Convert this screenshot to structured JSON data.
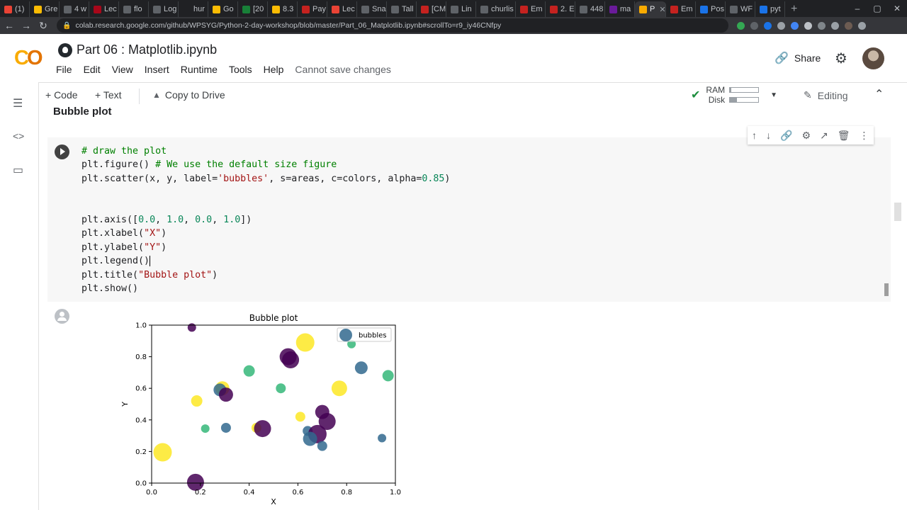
{
  "browser": {
    "tabs": [
      {
        "label": "(1)",
        "color": "#ea4335"
      },
      {
        "label": "Gre",
        "color": "#fbbc04"
      },
      {
        "label": "4 w",
        "color": "#5f6368"
      },
      {
        "label": "Lec",
        "color": "#a8071a"
      },
      {
        "label": "flo",
        "color": "#5f6368"
      },
      {
        "label": "Log",
        "color": "#5f6368"
      },
      {
        "label": "hur",
        "color": "#202124"
      },
      {
        "label": "Go",
        "color": "#fbbc04"
      },
      {
        "label": "[20",
        "color": "#188038"
      },
      {
        "label": "8.3",
        "color": "#fbbc04"
      },
      {
        "label": "Pay",
        "color": "#c5221f"
      },
      {
        "label": "Lec",
        "color": "#ea4335"
      },
      {
        "label": "Sna",
        "color": "#5f6368"
      },
      {
        "label": "Tall",
        "color": "#5f6368"
      },
      {
        "label": "[CM",
        "color": "#c5221f"
      },
      {
        "label": "Lin",
        "color": "#5f6368"
      },
      {
        "label": "churlis",
        "color": "#5f6368"
      },
      {
        "label": "Em",
        "color": "#c5221f"
      },
      {
        "label": "2. E",
        "color": "#c5221f"
      },
      {
        "label": "448",
        "color": "#5f6368"
      },
      {
        "label": "ma",
        "color": "#6a1b9a"
      },
      {
        "label": "P",
        "color": "#f9ab00",
        "active": true
      },
      {
        "label": "Em",
        "color": "#c5221f"
      },
      {
        "label": "Pos",
        "color": "#1a73e8"
      },
      {
        "label": "WF",
        "color": "#5f6368"
      },
      {
        "label": "pyt",
        "color": "#1a73e8"
      }
    ],
    "new_tab": "+",
    "window_controls": [
      "–",
      "▢",
      "✕"
    ],
    "url": "colab.research.google.com/github/WPSYG/Python-2-day-workshop/blob/master/Part_06_Matplotlib.ipynb#scrollTo=r9_iy46CNfpy"
  },
  "colab": {
    "logo_left": "C",
    "logo_right": "O",
    "title": "Part 06 : Matplotlib.ipynb",
    "menu": [
      "File",
      "Edit",
      "View",
      "Insert",
      "Runtime",
      "Tools",
      "Help"
    ],
    "menu_status": "Cannot save changes",
    "share_label": "Share"
  },
  "toolbar": {
    "code_label": "+ Code",
    "text_label": "+ Text",
    "copy_label": "Copy to Drive",
    "ram_label": "RAM",
    "disk_label": "Disk",
    "ram_level": 0.05,
    "disk_level": 0.25,
    "editing_label": "Editing"
  },
  "notebook": {
    "section_title": "Bubble plot",
    "code_lines": [
      [
        {
          "t": "# draw the plot",
          "c": "cm"
        }
      ],
      [
        {
          "t": "plt.figure() "
        },
        {
          "t": "# We use the default size figure",
          "c": "cm"
        }
      ],
      [
        {
          "t": "plt.scatter(x, y, label="
        },
        {
          "t": "'bubbles'",
          "c": "st"
        },
        {
          "t": ", s=areas, c=colors, alpha="
        },
        {
          "t": "0.85",
          "c": "nu"
        },
        {
          "t": ")"
        }
      ],
      [
        {
          "t": ""
        }
      ],
      [
        {
          "t": ""
        }
      ],
      [
        {
          "t": "plt.axis(["
        },
        {
          "t": "0.0",
          "c": "nu"
        },
        {
          "t": ", "
        },
        {
          "t": "1.0",
          "c": "nu"
        },
        {
          "t": ", "
        },
        {
          "t": "0.0",
          "c": "nu"
        },
        {
          "t": ", "
        },
        {
          "t": "1.0",
          "c": "nu"
        },
        {
          "t": "])"
        }
      ],
      [
        {
          "t": "plt.xlabel("
        },
        {
          "t": "\"X\"",
          "c": "st"
        },
        {
          "t": ")"
        }
      ],
      [
        {
          "t": "plt.ylabel("
        },
        {
          "t": "\"Y\"",
          "c": "st"
        },
        {
          "t": ")"
        }
      ],
      [
        {
          "t": "plt.legend()"
        },
        {
          "cursor": true
        }
      ],
      [
        {
          "t": "plt.title("
        },
        {
          "t": "\"Bubble plot\"",
          "c": "st"
        },
        {
          "t": ")"
        }
      ],
      [
        {
          "t": "plt.show()"
        }
      ]
    ]
  },
  "chart_data": {
    "type": "scatter",
    "title": "Bubble plot",
    "xlabel": "X",
    "ylabel": "Y",
    "xlim": [
      0.0,
      1.0
    ],
    "ylim": [
      0.0,
      1.0
    ],
    "xticks": [
      "0.0",
      "0.2",
      "0.4",
      "0.6",
      "0.8",
      "1.0"
    ],
    "yticks": [
      "0.0",
      "0.2",
      "0.4",
      "0.6",
      "0.8",
      "1.0"
    ],
    "grid": false,
    "legend": {
      "position": "top-right",
      "entries": [
        {
          "label": "bubbles",
          "color": "#31688e"
        }
      ]
    },
    "points": [
      {
        "x": 0.165,
        "y": 0.985,
        "size": 6,
        "color": "#440154"
      },
      {
        "x": 0.63,
        "y": 0.89,
        "size": 13,
        "color": "#fde725"
      },
      {
        "x": 0.82,
        "y": 0.88,
        "size": 6,
        "color": "#35b779"
      },
      {
        "x": 0.56,
        "y": 0.8,
        "size": 12,
        "color": "#440154"
      },
      {
        "x": 0.57,
        "y": 0.78,
        "size": 12,
        "color": "#440154"
      },
      {
        "x": 0.86,
        "y": 0.73,
        "size": 9,
        "color": "#31688e"
      },
      {
        "x": 0.4,
        "y": 0.71,
        "size": 8,
        "color": "#35b779"
      },
      {
        "x": 0.97,
        "y": 0.68,
        "size": 8,
        "color": "#35b779"
      },
      {
        "x": 0.29,
        "y": 0.6,
        "size": 10,
        "color": "#fde725"
      },
      {
        "x": 0.77,
        "y": 0.6,
        "size": 11,
        "color": "#fde725"
      },
      {
        "x": 0.53,
        "y": 0.6,
        "size": 7,
        "color": "#35b779"
      },
      {
        "x": 0.28,
        "y": 0.59,
        "size": 9,
        "color": "#31688e"
      },
      {
        "x": 0.305,
        "y": 0.56,
        "size": 10,
        "color": "#440154"
      },
      {
        "x": 0.185,
        "y": 0.52,
        "size": 8,
        "color": "#fde725"
      },
      {
        "x": 0.7,
        "y": 0.45,
        "size": 10,
        "color": "#440154"
      },
      {
        "x": 0.61,
        "y": 0.42,
        "size": 7,
        "color": "#fde725"
      },
      {
        "x": 0.72,
        "y": 0.39,
        "size": 12,
        "color": "#440154"
      },
      {
        "x": 0.22,
        "y": 0.345,
        "size": 6,
        "color": "#35b779"
      },
      {
        "x": 0.305,
        "y": 0.35,
        "size": 7,
        "color": "#31688e"
      },
      {
        "x": 0.43,
        "y": 0.35,
        "size": 7,
        "color": "#fde725"
      },
      {
        "x": 0.455,
        "y": 0.345,
        "size": 12,
        "color": "#440154"
      },
      {
        "x": 0.64,
        "y": 0.33,
        "size": 7,
        "color": "#31688e"
      },
      {
        "x": 0.68,
        "y": 0.31,
        "size": 13,
        "color": "#440154"
      },
      {
        "x": 0.65,
        "y": 0.28,
        "size": 10,
        "color": "#31688e"
      },
      {
        "x": 0.7,
        "y": 0.235,
        "size": 7,
        "color": "#31688e"
      },
      {
        "x": 0.945,
        "y": 0.285,
        "size": 6,
        "color": "#31688e"
      },
      {
        "x": 0.045,
        "y": 0.195,
        "size": 13,
        "color": "#fde725"
      },
      {
        "x": 0.18,
        "y": 0.005,
        "size": 12,
        "color": "#440154"
      }
    ]
  }
}
